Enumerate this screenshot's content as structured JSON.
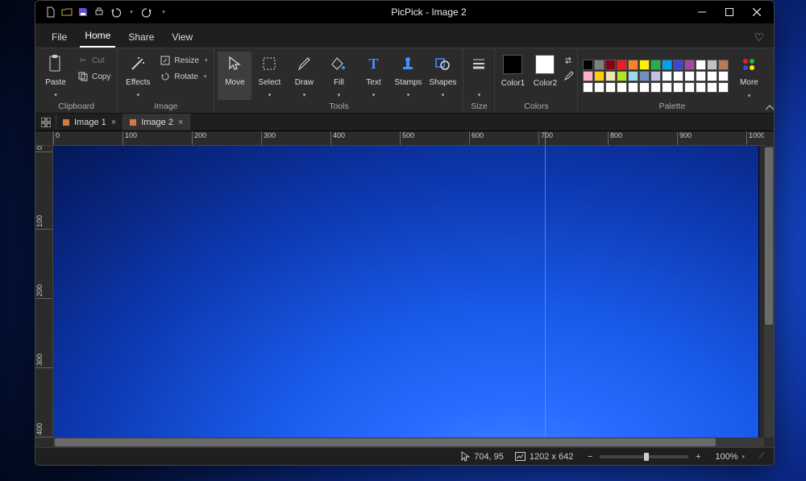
{
  "title": "PicPick - Image 2",
  "menubar": {
    "file": "File",
    "home": "Home",
    "share": "Share",
    "view": "View"
  },
  "ribbon": {
    "clipboard": {
      "label": "Clipboard",
      "paste": "Paste",
      "cut": "Cut",
      "copy": "Copy"
    },
    "image": {
      "label": "Image",
      "effects": "Effects",
      "resize": "Resize",
      "rotate": "Rotate"
    },
    "tools": {
      "label": "Tools",
      "move": "Move",
      "select": "Select",
      "draw": "Draw",
      "fill": "Fill",
      "text": "Text",
      "stamps": "Stamps",
      "shapes": "Shapes"
    },
    "size": {
      "label": "Size"
    },
    "colors": {
      "label": "Colors",
      "color1": "Color1",
      "color2": "Color2",
      "color1_value": "#000000",
      "color2_value": "#ffffff"
    },
    "palette": {
      "label": "Palette",
      "more": "More",
      "rows": [
        [
          "#000000",
          "#7f7f7f",
          "#870014",
          "#ed1c24",
          "#ff7f27",
          "#fff200",
          "#22b14c",
          "#00a2e8",
          "#3f48cc",
          "#a349a4",
          "#ffffff",
          "#c3c3c3",
          "#b97a57"
        ],
        [
          "#ffaec9",
          "#ffc90e",
          "#efe4b0",
          "#b5e61d",
          "#99d9ea",
          "#7092be",
          "#c8bfe7",
          "#ffffff",
          "#ffffff",
          "#ffffff",
          "#ffffff",
          "#ffffff",
          "#ffffff"
        ],
        [
          "#ffffff",
          "#ffffff",
          "#ffffff",
          "#ffffff",
          "#ffffff",
          "#ffffff",
          "#ffffff",
          "#ffffff",
          "#ffffff",
          "#ffffff",
          "#ffffff",
          "#ffffff",
          "#ffffff"
        ]
      ]
    }
  },
  "doctabs": {
    "tab1": "Image 1",
    "tab2": "Image 2"
  },
  "ruler_h": [
    "0",
    "100",
    "200",
    "300",
    "400",
    "500",
    "600",
    "700",
    "800",
    "900",
    "1000"
  ],
  "ruler_v": [
    "0",
    "100",
    "200",
    "300",
    "400"
  ],
  "statusbar": {
    "cursor": "704, 95",
    "dims": "1202 x 642",
    "zoom": "100%"
  }
}
